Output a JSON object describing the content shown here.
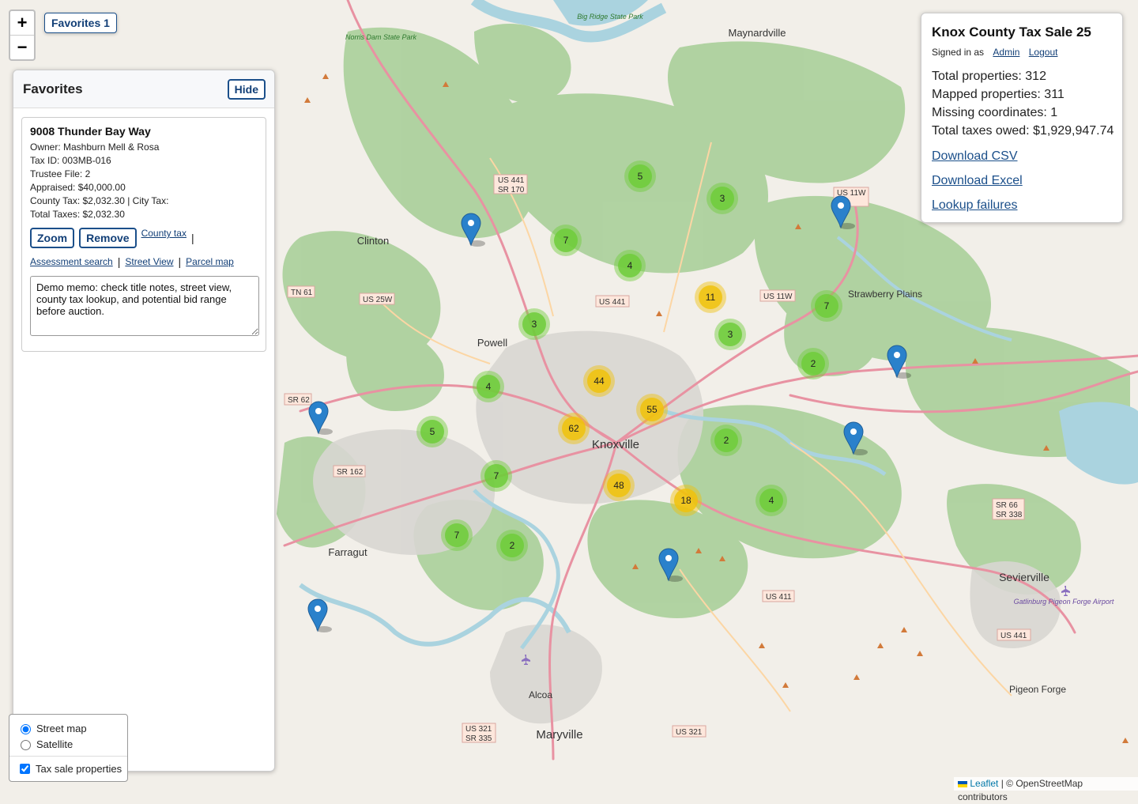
{
  "map_ui": {
    "zoom_in": "+",
    "zoom_out": "−",
    "favorites_toggle": "Favorites 1",
    "attribution_leaflet": "Leaflet",
    "attribution_rest": "| © OpenStreetMap contributors"
  },
  "favorites": {
    "title": "Favorites",
    "hide_label": "Hide",
    "items": [
      {
        "address": "9008 Thunder Bay Way",
        "owner": "Owner: Mashburn Mell & Rosa",
        "tax_id": "Tax ID: 003MB-016",
        "trustee_file": "Trustee File: 2",
        "appraised": "Appraised: $40,000.00",
        "county_city_tax": "County Tax: $2,032.30 | City Tax:",
        "total_taxes": "Total Taxes: $2,032.30",
        "zoom_label": "Zoom",
        "remove_label": "Remove",
        "county_tax_link": "County tax",
        "assessment_link": "Assessment search",
        "street_view_link": "Street View",
        "parcel_map_link": "Parcel map",
        "memo": "Demo memo: check title notes, street view, county tax lookup, and potential bid range before auction."
      }
    ]
  },
  "layers": {
    "street": "Street map",
    "satellite": "Satellite",
    "tax_sale": "Tax sale properties",
    "selected_base": "Street map",
    "tax_sale_checked": true
  },
  "info": {
    "title": "Knox County Tax Sale 25",
    "signed_in": "Signed in as",
    "admin": "Admin",
    "logout": "Logout",
    "total_properties": "Total properties: 312",
    "mapped_properties": "Mapped properties: 311",
    "missing_coordinates": "Missing coordinates: 1",
    "total_taxes": "Total taxes owed: $1,929,947.74",
    "download_csv": "Download CSV",
    "download_excel": "Download Excel",
    "lookup_failures": "Lookup failures"
  },
  "map_labels": {
    "towns": [
      "Maynardville",
      "Clinton",
      "Powell",
      "Knoxville",
      "Farragut",
      "Strawberry Plains",
      "Alcoa",
      "Maryville",
      "Sevierville",
      "Pigeon Forge"
    ],
    "parks": [
      "Norris Dam State Park",
      "Big Ridge State Park"
    ],
    "airport": "Gatlinburg Pigeon Forge Airport",
    "route_shields": [
      "US 441",
      "SR 170",
      "US 441",
      "US 11W",
      "US 11W",
      "TN 61",
      "US 25W",
      "SR 62",
      "SR 162",
      "US 411",
      "US 321",
      "SR 335",
      "US 321",
      "SR 66",
      "SR 338",
      "US 441"
    ]
  },
  "clusters": [
    {
      "count": "5",
      "level": "small"
    },
    {
      "count": "3",
      "level": "small"
    },
    {
      "count": "7",
      "level": "small"
    },
    {
      "count": "4",
      "level": "small"
    },
    {
      "count": "11",
      "level": "medium"
    },
    {
      "count": "7",
      "level": "small"
    },
    {
      "count": "3",
      "level": "small"
    },
    {
      "count": "3",
      "level": "small"
    },
    {
      "count": "2",
      "level": "small"
    },
    {
      "count": "4",
      "level": "small"
    },
    {
      "count": "44",
      "level": "medium"
    },
    {
      "count": "55",
      "level": "medium"
    },
    {
      "count": "62",
      "level": "medium"
    },
    {
      "count": "5",
      "level": "small"
    },
    {
      "count": "2",
      "level": "small"
    },
    {
      "count": "7",
      "level": "small"
    },
    {
      "count": "48",
      "level": "medium"
    },
    {
      "count": "18",
      "level": "medium"
    },
    {
      "count": "4",
      "level": "small"
    },
    {
      "count": "7",
      "level": "small"
    },
    {
      "count": "2",
      "level": "small"
    }
  ],
  "colors": {
    "land": "#f2efe9",
    "forest": "#add19e",
    "urban": "#d8d6d2",
    "water": "#aad3df",
    "highway": "#e892a2",
    "cluster_small": "#6ecc39",
    "cluster_medium": "#f0c20c",
    "marker": "#2a81cb",
    "link": "#123f77"
  }
}
